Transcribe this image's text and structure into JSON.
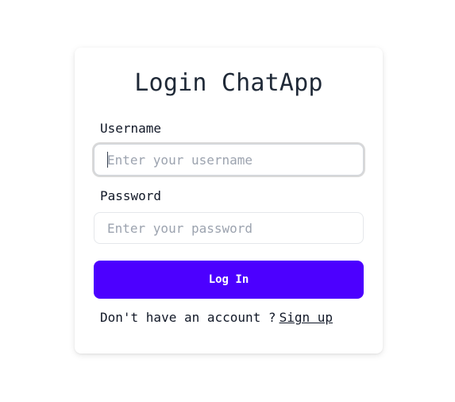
{
  "login": {
    "title": "Login ChatApp",
    "username_label": "Username",
    "username_placeholder": "Enter your username",
    "username_value": "",
    "password_label": "Password",
    "password_placeholder": "Enter your password",
    "password_value": "",
    "submit_label": "Log In",
    "no_account_text": "Don't have an account ?",
    "signup_link": "Sign up"
  },
  "colors": {
    "primary_button": "#4c00ff",
    "text": "#111827",
    "placeholder": "#9ca3af"
  }
}
